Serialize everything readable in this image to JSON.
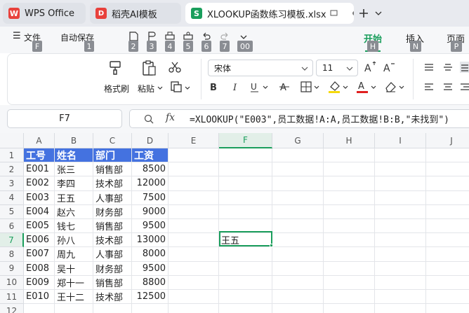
{
  "tabs": [
    {
      "label": "WPS Office",
      "logo": "W"
    },
    {
      "label": "稻壳AI模板",
      "logo": "D"
    },
    {
      "label": "XLOOKUP函数练习模板.xlsx",
      "logo": "S"
    }
  ],
  "menu": {
    "file": "文件",
    "autosave": "自动保存",
    "start": "开始",
    "insert": "插入",
    "page": "页面"
  },
  "keytips": [
    "F",
    "1",
    "2",
    "3",
    "4",
    "5",
    "6",
    "7",
    "00",
    "H",
    "N",
    "P"
  ],
  "ribbon": {
    "format_painter": "格式刷",
    "paste": "粘贴",
    "font_name": "宋体",
    "font_size": "11"
  },
  "formula_bar": {
    "name_box": "F7",
    "fx": "fx",
    "formula": "=XLOOKUP(\"E003\",员工数据!A:A,员工数据!B:B,\"未找到\")"
  },
  "columns": [
    "A",
    "B",
    "C",
    "D",
    "E",
    "F",
    "G",
    "H",
    "I",
    "J"
  ],
  "rows": [
    "1",
    "2",
    "3",
    "4",
    "5",
    "6",
    "7",
    "8",
    "9",
    "10",
    "11",
    "12"
  ],
  "table": {
    "headers": [
      "工号",
      "姓名",
      "部门",
      "工资"
    ],
    "data": [
      [
        "E001",
        "张三",
        "销售部",
        "8500"
      ],
      [
        "E002",
        "李四",
        "技术部",
        "12000"
      ],
      [
        "E003",
        "王五",
        "人事部",
        "7500"
      ],
      [
        "E004",
        "赵六",
        "财务部",
        "9000"
      ],
      [
        "E005",
        "钱七",
        "销售部",
        "9500"
      ],
      [
        "E006",
        "孙八",
        "技术部",
        "13000"
      ],
      [
        "E007",
        "周九",
        "人事部",
        "8000"
      ],
      [
        "E008",
        "吴十",
        "财务部",
        "9500"
      ],
      [
        "E009",
        "郑十一",
        "销售部",
        "8800"
      ],
      [
        "E010",
        "王十二",
        "技术部",
        "12500"
      ]
    ]
  },
  "active_cell": {
    "ref": "F7",
    "value": "王五"
  },
  "colors": {
    "accent": "#1a9e5c",
    "header_fill": "#4472e0",
    "wps_red": "#e8413c"
  }
}
